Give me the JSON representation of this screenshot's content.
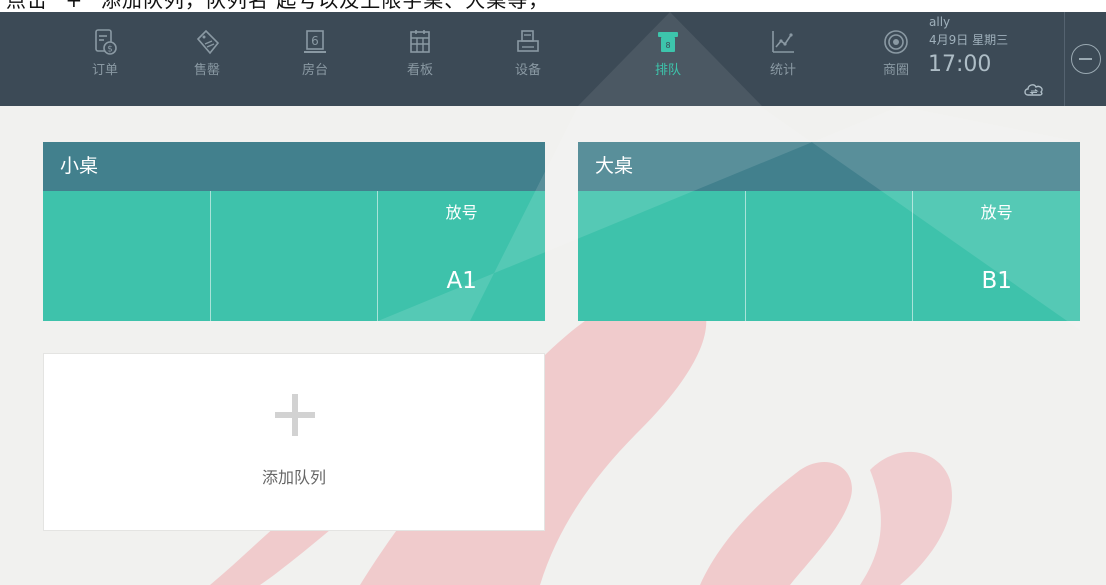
{
  "caption": {
    "text": "点击 \"+\" 添加队列，队列名 起号以及上限字桌、大桌等，"
  },
  "nav": {
    "items": [
      {
        "label": "订单",
        "icon": "order-dollar-icon",
        "active": false
      },
      {
        "label": "售罄",
        "icon": "sold-out-tag-icon",
        "active": false
      },
      {
        "label": "房台",
        "icon": "table-number-icon",
        "active": false
      },
      {
        "label": "看板",
        "icon": "board-grid-icon",
        "active": false
      },
      {
        "label": "设备",
        "icon": "printer-device-icon",
        "active": false
      },
      {
        "label": "排队",
        "icon": "queue-ticket-icon",
        "active": true
      },
      {
        "label": "统计",
        "icon": "stats-line-icon",
        "active": false
      },
      {
        "label": "商圈",
        "icon": "target-circle-icon",
        "active": false
      }
    ]
  },
  "status": {
    "user": "ally",
    "date": "4月9日 星期三",
    "time": "17:00",
    "cloud_icon": "cloud-sync-icon",
    "power_icon": "power-circle-icon"
  },
  "colors": {
    "topbar": "#3c4a56",
    "accent": "#3dc5ac",
    "queue_header": "#42808d",
    "queue_body": "#3ec2ab"
  },
  "queues": [
    {
      "name": "小桌",
      "action_label": "放号",
      "number": "A1"
    },
    {
      "name": "大桌",
      "action_label": "放号",
      "number": "B1"
    }
  ],
  "add_queue": {
    "label": "添加队列",
    "icon": "plus-icon"
  }
}
